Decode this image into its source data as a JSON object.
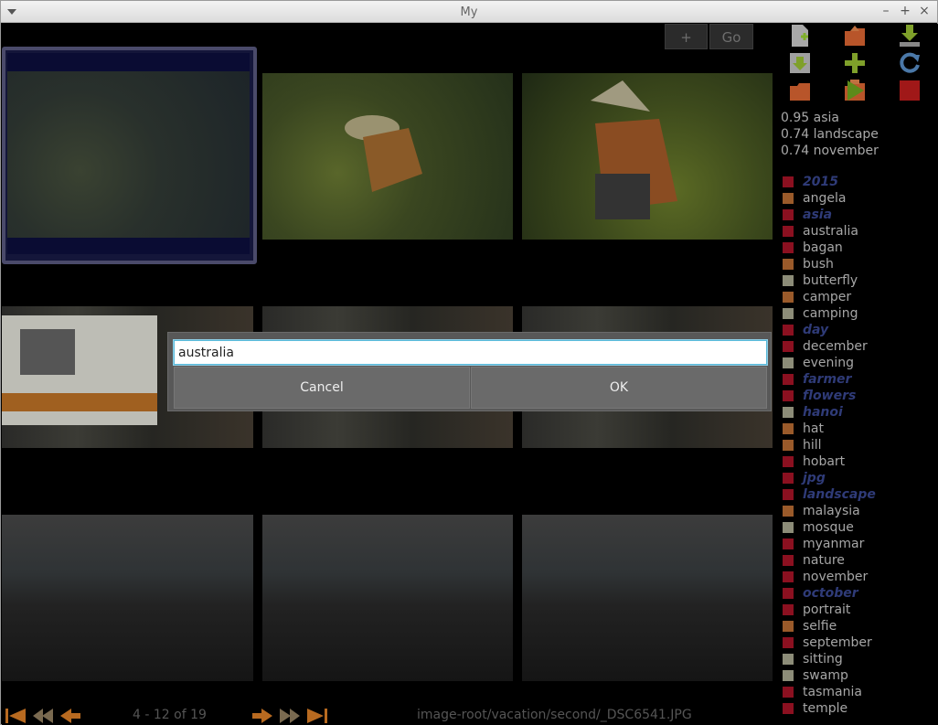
{
  "window": {
    "title": "My"
  },
  "toolbar": {
    "plus_label": "+",
    "go_label": "Go"
  },
  "scores": [
    "0.95 asia",
    "0.74 landscape",
    "0.74 november"
  ],
  "tags": [
    {
      "label": "2015",
      "color": "#8b1020",
      "highlight": true
    },
    {
      "label": "angela",
      "color": "#9a5a2a",
      "highlight": false
    },
    {
      "label": "asia",
      "color": "#8b1020",
      "highlight": true
    },
    {
      "label": "australia",
      "color": "#8b1020",
      "highlight": false
    },
    {
      "label": "bagan",
      "color": "#8b1020",
      "highlight": false
    },
    {
      "label": "bush",
      "color": "#9a5a2a",
      "highlight": false
    },
    {
      "label": "butterfly",
      "color": "#8c8c78",
      "highlight": false
    },
    {
      "label": "camper",
      "color": "#9a5a2a",
      "highlight": false
    },
    {
      "label": "camping",
      "color": "#8c8c78",
      "highlight": false
    },
    {
      "label": "day",
      "color": "#8b1020",
      "highlight": true
    },
    {
      "label": "december",
      "color": "#8b1020",
      "highlight": false
    },
    {
      "label": "evening",
      "color": "#8c8c78",
      "highlight": false
    },
    {
      "label": "farmer",
      "color": "#8b1020",
      "highlight": true
    },
    {
      "label": "flowers",
      "color": "#8b1020",
      "highlight": true
    },
    {
      "label": "hanoi",
      "color": "#8c8c78",
      "highlight": true
    },
    {
      "label": "hat",
      "color": "#9a5a2a",
      "highlight": false
    },
    {
      "label": "hill",
      "color": "#9a5a2a",
      "highlight": false
    },
    {
      "label": "hobart",
      "color": "#8b1020",
      "highlight": false
    },
    {
      "label": "jpg",
      "color": "#8b1020",
      "highlight": true
    },
    {
      "label": "landscape",
      "color": "#8b1020",
      "highlight": true
    },
    {
      "label": "malaysia",
      "color": "#9a5a2a",
      "highlight": false
    },
    {
      "label": "mosque",
      "color": "#8c8c78",
      "highlight": false
    },
    {
      "label": "myanmar",
      "color": "#8b1020",
      "highlight": false
    },
    {
      "label": "nature",
      "color": "#8b1020",
      "highlight": false
    },
    {
      "label": "november",
      "color": "#8b1020",
      "highlight": false
    },
    {
      "label": "october",
      "color": "#8b1020",
      "highlight": true
    },
    {
      "label": "portrait",
      "color": "#8b1020",
      "highlight": false
    },
    {
      "label": "selfie",
      "color": "#9a5a2a",
      "highlight": false
    },
    {
      "label": "september",
      "color": "#8b1020",
      "highlight": false
    },
    {
      "label": "sitting",
      "color": "#8c8c78",
      "highlight": false
    },
    {
      "label": "swamp",
      "color": "#8c8c78",
      "highlight": false
    },
    {
      "label": "tasmania",
      "color": "#8b1020",
      "highlight": false
    },
    {
      "label": "temple",
      "color": "#8b1020",
      "highlight": false
    }
  ],
  "dialog": {
    "input_value": "australia",
    "cancel_label": "Cancel",
    "ok_label": "OK"
  },
  "footer": {
    "pager": "4 - 12 of 19",
    "path": "image-root/vacation/second/_DSC6541.JPG"
  }
}
